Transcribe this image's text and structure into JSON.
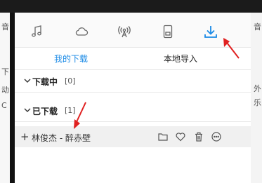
{
  "nav": {
    "icons": [
      "music-note-icon",
      "cloud-icon",
      "radio-icon",
      "device-icon",
      "download-icon"
    ],
    "active_color": "#1a8ae6"
  },
  "tabs": {
    "my_downloads": "我的下载",
    "local_import": "本地导入"
  },
  "sections": {
    "downloading": {
      "title": "下载中",
      "count": "[0]"
    },
    "downloaded": {
      "title": "已下载",
      "count": "[1]"
    }
  },
  "track": {
    "title": "林俊杰 - 醉赤壁"
  },
  "background": {
    "left_chars": [
      "音",
      "下",
      "动",
      "C"
    ],
    "right_chars": [
      "音",
      "外",
      "乐"
    ]
  }
}
